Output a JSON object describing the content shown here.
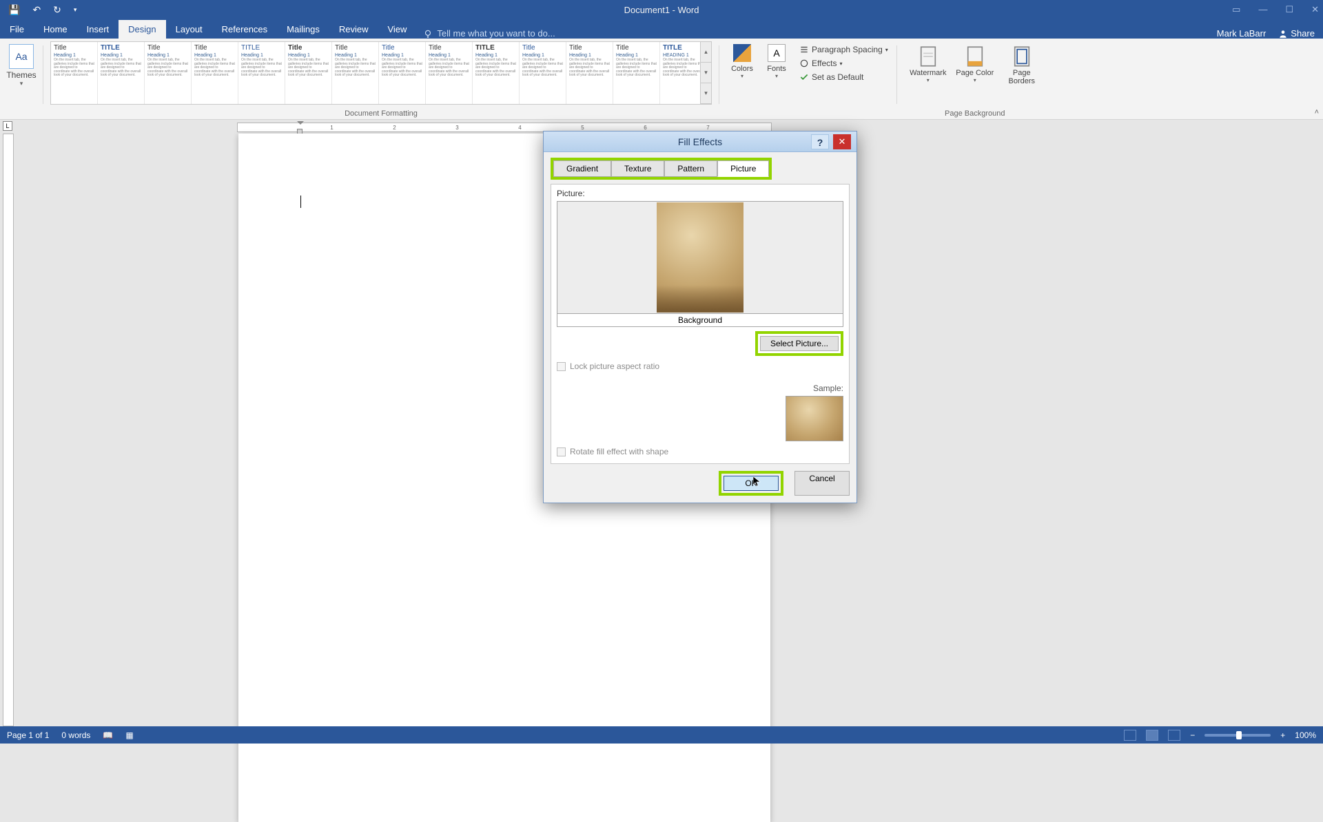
{
  "titlebar": {
    "doc_title": "Document1 - Word"
  },
  "ribbon_tabs": {
    "file": "File",
    "home": "Home",
    "insert": "Insert",
    "design": "Design",
    "layout": "Layout",
    "references": "References",
    "mailings": "Mailings",
    "review": "Review",
    "view": "View",
    "tell_me": "Tell me what you want to do...",
    "user": "Mark LaBarr",
    "share": "Share"
  },
  "ribbon": {
    "themes_label": "Themes",
    "doc_formatting_label": "Document Formatting",
    "style_cards": [
      {
        "title": "Title",
        "h1": "Heading 1"
      },
      {
        "title": "TITLE",
        "h1": "Heading 1"
      },
      {
        "title": "Title",
        "h1": "Heading 1"
      },
      {
        "title": "Title",
        "h1": "Heading 1"
      },
      {
        "title": "TITLE",
        "h1": "Heading 1"
      },
      {
        "title": "Title",
        "h1": "Heading 1"
      },
      {
        "title": "Title",
        "h1": "Heading 1"
      },
      {
        "title": "Title",
        "h1": "Heading 1"
      },
      {
        "title": "Title",
        "h1": "Heading 1"
      },
      {
        "title": "TITLE",
        "h1": "Heading 1"
      },
      {
        "title": "Title",
        "h1": "Heading 1"
      },
      {
        "title": "Title",
        "h1": "Heading 1"
      },
      {
        "title": "Title",
        "h1": "Heading 1"
      },
      {
        "title": "TITLE",
        "h1": "HEADING 1"
      }
    ],
    "colors_label": "Colors",
    "fonts_label": "Fonts",
    "para_spacing": "Paragraph Spacing",
    "effects": "Effects",
    "set_default": "Set as Default",
    "watermark": "Watermark",
    "page_color": "Page Color",
    "page_borders": "Page Borders",
    "page_bg_label": "Page Background"
  },
  "ruler": {
    "marks": [
      "1",
      "2",
      "3",
      "4",
      "5",
      "6",
      "7"
    ]
  },
  "dialog": {
    "title": "Fill Effects",
    "tabs": {
      "gradient": "Gradient",
      "texture": "Texture",
      "pattern": "Pattern",
      "picture": "Picture"
    },
    "picture_label": "Picture:",
    "background_name": "Background",
    "select_picture": "Select Picture...",
    "lock_aspect": "Lock picture aspect ratio",
    "sample_label": "Sample:",
    "rotate_fill": "Rotate fill effect with shape",
    "ok": "OK",
    "cancel": "Cancel"
  },
  "status": {
    "page_info": "Page 1 of 1",
    "word_count": "0 words",
    "zoom_btn": "+",
    "zoom_minus": "−",
    "zoom_pct": "100%"
  }
}
